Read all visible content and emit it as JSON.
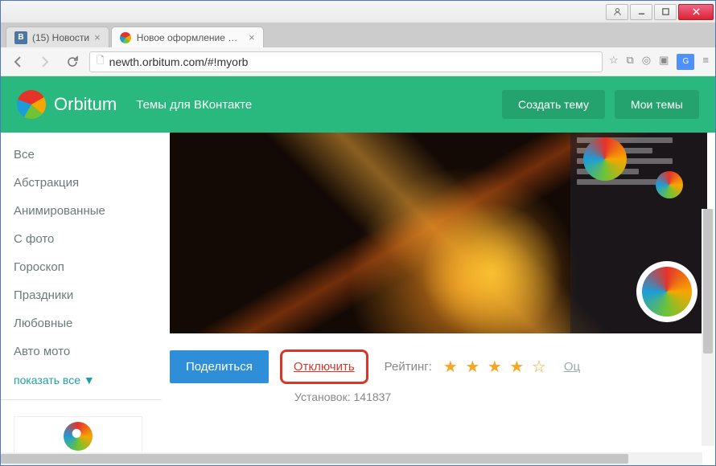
{
  "tabs": [
    {
      "label": "(15) Новости",
      "favicon": "vk"
    },
    {
      "label": "Новое оформление ВКон",
      "favicon": "orbitum"
    }
  ],
  "address_bar": {
    "url": "newth.orbitum.com/#!myorb"
  },
  "header": {
    "brand": "Orbitum",
    "subtitle": "Темы для ВКонтакте",
    "create_btn": "Создать тему",
    "my_themes_btn": "Мои темы"
  },
  "sidebar": {
    "categories": [
      "Все",
      "Абстракция",
      "Анимированные",
      "С фото",
      "Гороскоп",
      "Праздники",
      "Любовные",
      "Авто мото"
    ],
    "show_all": "показать все ▼"
  },
  "theme": {
    "share_btn": "Поделиться",
    "disable_link": "Отключить",
    "rating_label": "Рейтинг:",
    "rating_value": 4,
    "rating_max": 5,
    "review_link": "Оц",
    "installs_label": "Установок:",
    "installs_count": "141837"
  }
}
